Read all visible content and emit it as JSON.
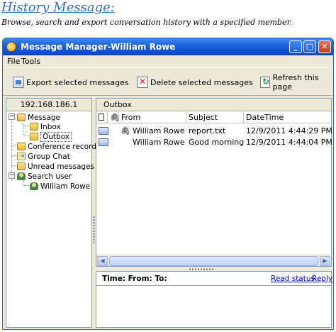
{
  "page": {
    "heading": "History Message:",
    "subheading": "Browse, search and export conversation history with a specified member."
  },
  "window": {
    "title": "Message Manager-William Rowe",
    "buttons": {
      "minimize": "_",
      "maximize": "□",
      "close": "✕"
    }
  },
  "menu": [
    "File",
    "Tools"
  ],
  "toolbar": {
    "export_label": "Export selected messages",
    "delete_label": "Delete selected messages",
    "refresh_label": "Refresh this page"
  },
  "sidebar": {
    "ip": "192.168.186.1",
    "tree": {
      "message": "Message",
      "inbox": "Inbox",
      "outbox": "Outbox",
      "conference": "Conference record",
      "group_chat": "Group Chat",
      "unread": "Unread messages",
      "search_user": "Search user",
      "user": "William Rowe"
    }
  },
  "list": {
    "tab": "Outbox",
    "columns": {
      "from": "From",
      "subject": "Subject",
      "datetime": "DateTime"
    },
    "rows": [
      {
        "from": "William Rowe",
        "subject": "report.txt",
        "datetime": "12/9/2011 4:44:29 PM",
        "attachment": true
      },
      {
        "from": "William Rowe",
        "subject": "Good morning",
        "datetime": "12/9/2011 4:44:04 PM",
        "attachment": false
      }
    ]
  },
  "detail": {
    "header": "Time: From: To:",
    "read_status": "Read status",
    "reply": "Reply"
  }
}
